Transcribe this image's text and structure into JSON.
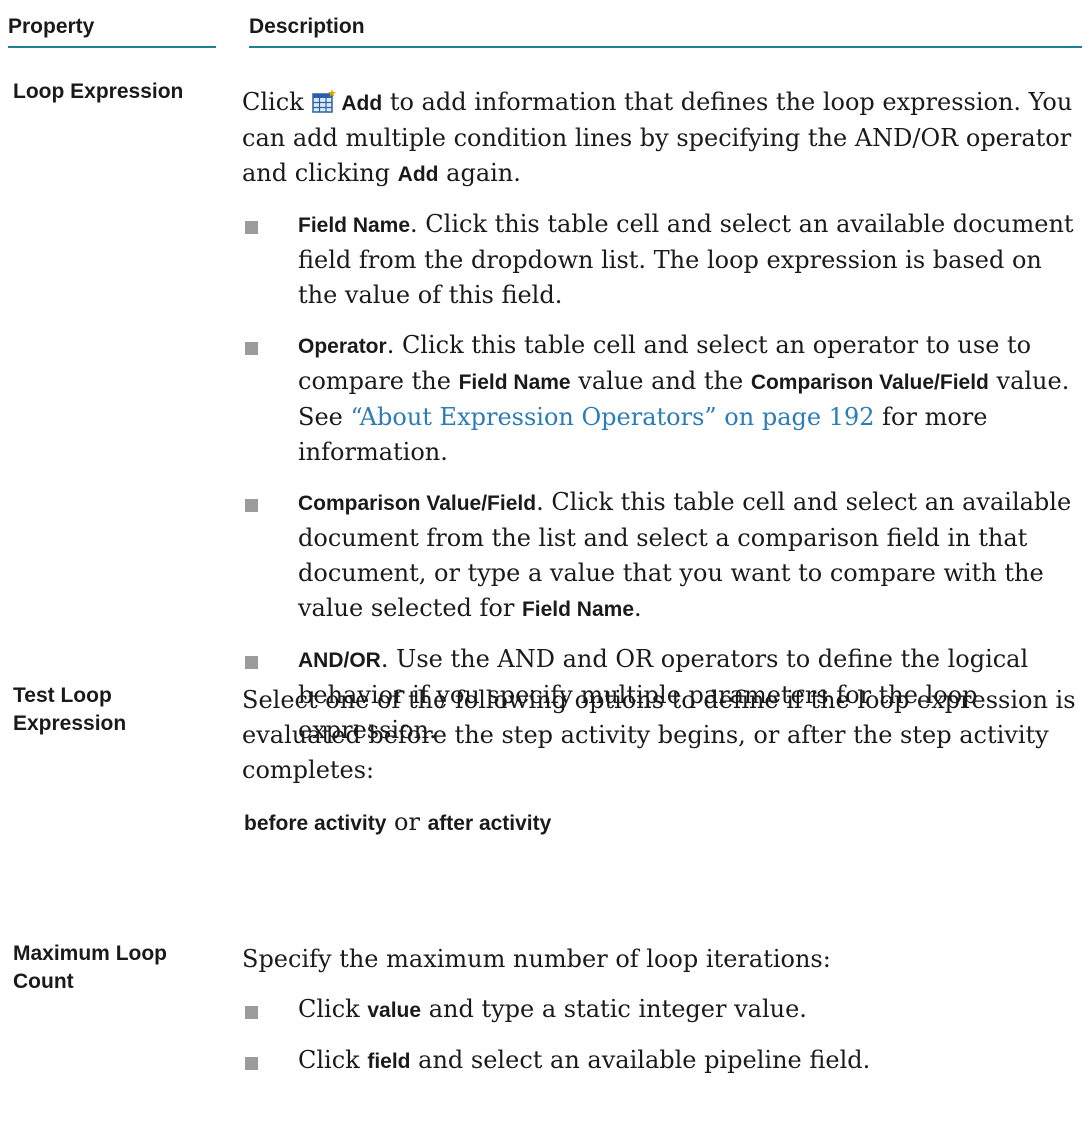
{
  "header": {
    "property": "Property",
    "description": "Description"
  },
  "rows": [
    {
      "property": "Loop Expression",
      "intro": {
        "click": "Click",
        "add": "Add",
        "text1": "to add information that defines the loop expression. You can add multiple condition lines by specifying the AND/OR operator and clicking",
        "add2": "Add",
        "text2": "again."
      },
      "bullets": [
        {
          "term": "Field Name",
          "text": ". Click this table cell and select an available document field from the dropdown list. The loop expression is based on the value of this field."
        },
        {
          "term": "Operator",
          "text1": ". Click this table cell and select an operator to use to compare the",
          "term2": "Field Name",
          "text2": "value and the",
          "term3": "Comparison Value/Field",
          "text3": "value. See",
          "link": "“About Expression Operators” on page 192",
          "text4": "for more information."
        },
        {
          "term": "Comparison Value/Field",
          "text1": ". Click this table cell and select an available document from the list and select a comparison field in that document, or type a value that you want to compare with the value selected for",
          "term2": "Field Name",
          "text2": "."
        },
        {
          "term": "AND/OR",
          "text": ". Use the AND and OR operators to define the logical behavior if you specify multiple parameters for the loop expression."
        }
      ]
    },
    {
      "property": "Test Loop Expression",
      "text": "Select one of the following options to define if the loop expression is evaluated before the step activity begins, or after the step activity completes:",
      "option1": "before activity",
      "or": "or",
      "option2": "after activity"
    },
    {
      "property": "Maximum Loop Count",
      "text": "Specify the maximum number of loop iterations:",
      "bullets": [
        {
          "click": "Click",
          "term": "value",
          "text": "and type a static integer value."
        },
        {
          "click": "Click",
          "term": "field",
          "text": "and select an available pipeline field."
        }
      ]
    }
  ]
}
